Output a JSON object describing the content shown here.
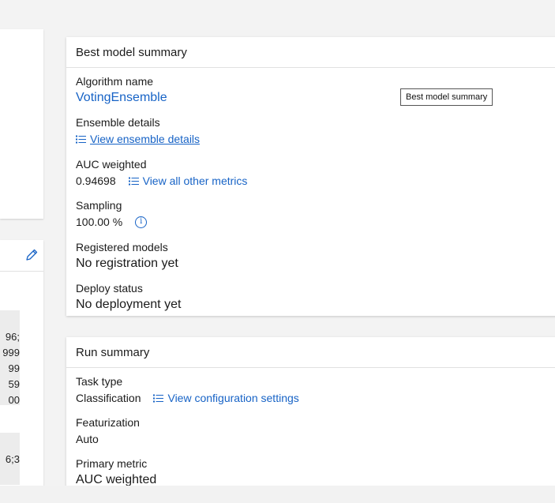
{
  "left_panel": {
    "code_lines_1": [
      "96;",
      "999",
      "99",
      "59",
      "00"
    ],
    "code_lines_2": [
      "6;3"
    ]
  },
  "best_model_summary": {
    "title": "Best model summary",
    "algorithm_label": "Algorithm name",
    "algorithm_value": "VotingEnsemble",
    "ensemble_label": "Ensemble details",
    "ensemble_link": "View ensemble details",
    "auc_label": "AUC weighted",
    "auc_value": "0.94698",
    "metrics_link": "View all other metrics",
    "sampling_label": "Sampling",
    "sampling_value": "100.00 %",
    "registered_label": "Registered models",
    "registered_value": "No registration yet",
    "deploy_label": "Deploy status",
    "deploy_value": "No deployment yet"
  },
  "tooltip": {
    "text": "Best model summary"
  },
  "run_summary": {
    "title": "Run summary",
    "task_label": "Task type",
    "task_value": "Classification",
    "config_link": "View configuration settings",
    "featurization_label": "Featurization",
    "featurization_value": "Auto",
    "primary_metric_label": "Primary metric",
    "primary_metric_value": "AUC weighted"
  },
  "colors": {
    "link": "#1763c6",
    "background": "#f3f3f3",
    "card": "#ffffff"
  }
}
